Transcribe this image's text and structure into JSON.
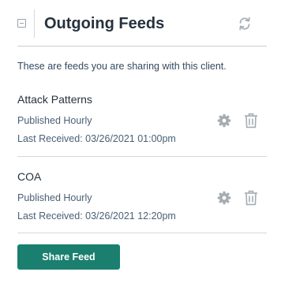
{
  "header": {
    "title": "Outgoing Feeds",
    "collapse_icon": "collapse-minus-icon",
    "refresh_icon": "refresh-icon"
  },
  "description": "These are feeds you are sharing with this client.",
  "feeds": [
    {
      "name": "Attack Patterns",
      "frequency": "Published Hourly",
      "last_received": "Last Received: 03/26/2021 01:00pm"
    },
    {
      "name": "COA",
      "frequency": "Published Hourly",
      "last_received": "Last Received: 03/26/2021 12:20pm"
    }
  ],
  "actions": {
    "share_label": "Share Feed"
  },
  "colors": {
    "accent": "#1a7f6e",
    "icon": "#9aa3ab",
    "text": "#26323d"
  }
}
